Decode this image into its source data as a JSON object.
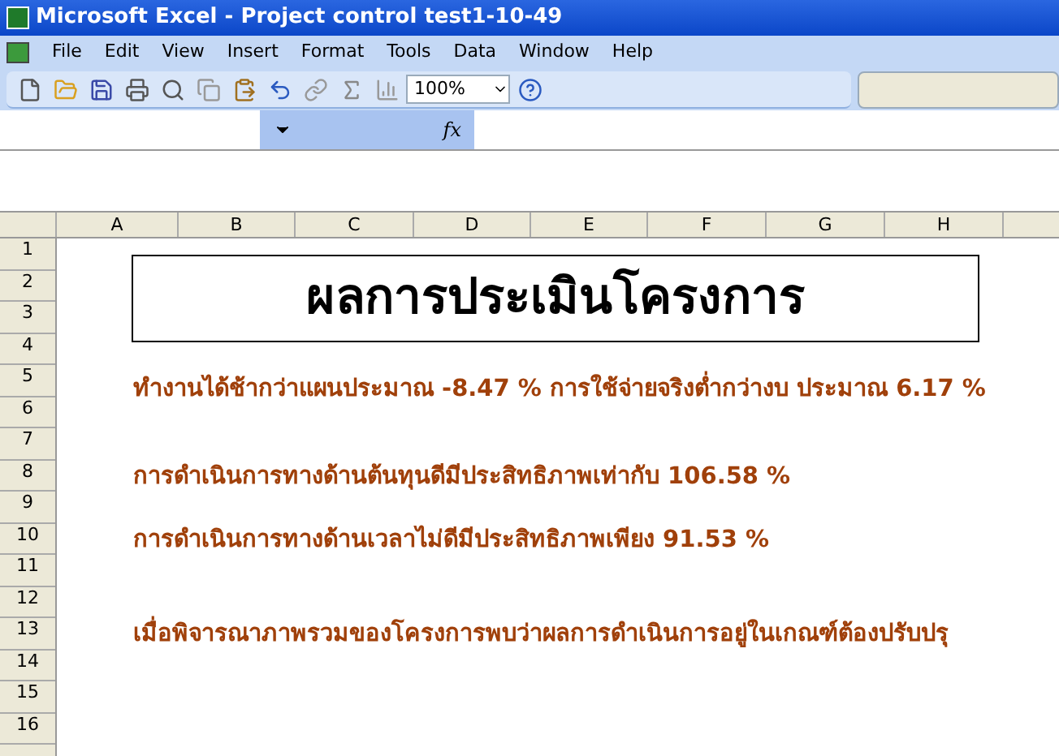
{
  "window": {
    "title": "Microsoft Excel - Project control test1-10-49"
  },
  "menu": [
    "File",
    "Edit",
    "View",
    "Insert",
    "Format",
    "Tools",
    "Data",
    "Window",
    "Help"
  ],
  "toolbar": {
    "zoom": "100%"
  },
  "formula_bar": {
    "fx": "fx"
  },
  "sheet": {
    "columns": [
      "A",
      "B",
      "C",
      "D",
      "E",
      "F",
      "G",
      "H"
    ],
    "rows": [
      "1",
      "2",
      "3",
      "4",
      "5",
      "6",
      "7",
      "8",
      "9",
      "10",
      "11",
      "12",
      "13",
      "14",
      "15",
      "16"
    ],
    "title": "ผลการประเมินโครงการ",
    "lines": [
      {
        "text": "ทำงานได้ช้ากว่าแผนประมาณ -8.47 % การใช้จ่ายจริงต่ำกว่างบ ประมาณ 6.17 %"
      },
      {
        "text": "การดำเนินการทางด้านต้นทุนดีมีประสิทธิภาพเท่ากับ 106.58 %"
      },
      {
        "text": "การดำเนินการทางด้านเวลาไม่ดีมีประสิทธิภาพเพียง 91.53 %"
      },
      {
        "text": "เมื่อพิจารณาภาพรวมของโครงการพบว่าผลการดำเนินการอยู่ในเกณฑ์ต้องปรับปรุ"
      }
    ]
  }
}
